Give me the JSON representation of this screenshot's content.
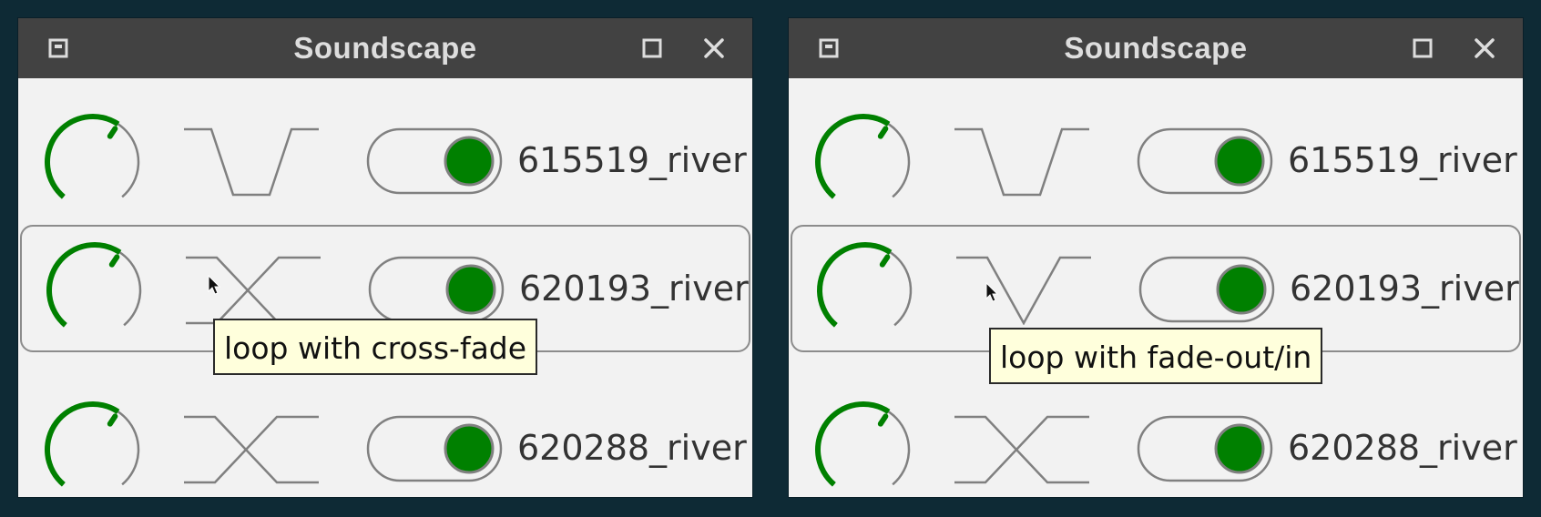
{
  "colors": {
    "desktop": "#0e2a35",
    "titlebar": "#424242",
    "title_text": "#dddddd",
    "window_bg": "#f2f2f2",
    "accent_green": "#008000",
    "outline_gray": "#808080",
    "tooltip_bg": "#ffffdc"
  },
  "windows": [
    {
      "title": "Soundscape",
      "tracks": [
        {
          "name": "615519_river",
          "volume": 0.62,
          "loop_mode": "fade-out/in",
          "enabled": true,
          "selected": false
        },
        {
          "name": "620193_river",
          "volume": 0.62,
          "loop_mode": "cross-fade",
          "enabled": true,
          "selected": true
        },
        {
          "name": "620288_river",
          "volume": 0.62,
          "loop_mode": "cross-fade",
          "enabled": true,
          "selected": false
        }
      ],
      "tooltip": "loop with cross-fade"
    },
    {
      "title": "Soundscape",
      "tracks": [
        {
          "name": "615519_river",
          "volume": 0.62,
          "loop_mode": "fade-out/in",
          "enabled": true,
          "selected": false
        },
        {
          "name": "620193_river",
          "volume": 0.62,
          "loop_mode": "fade-out/in",
          "enabled": true,
          "selected": true
        },
        {
          "name": "620288_river",
          "volume": 0.62,
          "loop_mode": "cross-fade",
          "enabled": true,
          "selected": false
        }
      ],
      "tooltip": "loop with fade-out/in"
    }
  ],
  "icons": {
    "window_menu": "window-menu-icon",
    "maximize": "maximize-icon",
    "close": "close-icon",
    "cursor": "mouse-pointer-icon"
  }
}
